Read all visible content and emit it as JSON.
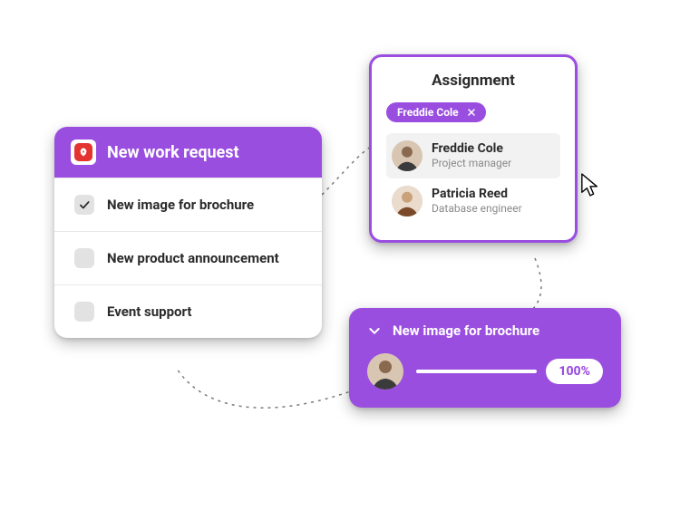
{
  "colors": {
    "accent": "#9a4ee0",
    "danger": "#e3342f"
  },
  "request": {
    "title": "New work request",
    "items": [
      {
        "label": "New image for brochure",
        "checked": true
      },
      {
        "label": "New product announcement",
        "checked": false
      },
      {
        "label": "Event support",
        "checked": false
      }
    ]
  },
  "assignment": {
    "title": "Assignment",
    "chip": {
      "label": "Freddie Cole"
    },
    "people": [
      {
        "name": "Freddie Cole",
        "role": "Project manager",
        "selected": true
      },
      {
        "name": "Patricia Reed",
        "role": "Database engineer",
        "selected": false
      }
    ]
  },
  "progress": {
    "title": "New image for brochure",
    "percent_label": "100%"
  }
}
